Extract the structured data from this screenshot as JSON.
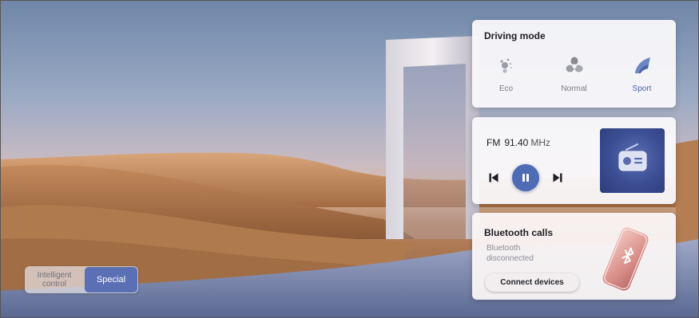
{
  "mode_toggle": {
    "options": [
      {
        "label": "Intelligent control"
      },
      {
        "label": "Special"
      }
    ],
    "selected": "Special"
  },
  "driving_mode": {
    "title": "Driving mode",
    "options": [
      {
        "label": "Eco",
        "icon": "eco-icon"
      },
      {
        "label": "Normal",
        "icon": "normal-fan-icon"
      },
      {
        "label": "Sport",
        "icon": "sport-wing-icon"
      }
    ],
    "selected": "Sport"
  },
  "radio": {
    "band": "FM",
    "frequency": "91.40",
    "unit": "MHz",
    "state": "playing"
  },
  "bluetooth": {
    "title": "Bluetooth calls",
    "status": "Bluetooth disconnected",
    "button_label": "Connect devices"
  },
  "colors": {
    "accent": "#4e6bb5",
    "toggle_active": "#5b70b4"
  }
}
